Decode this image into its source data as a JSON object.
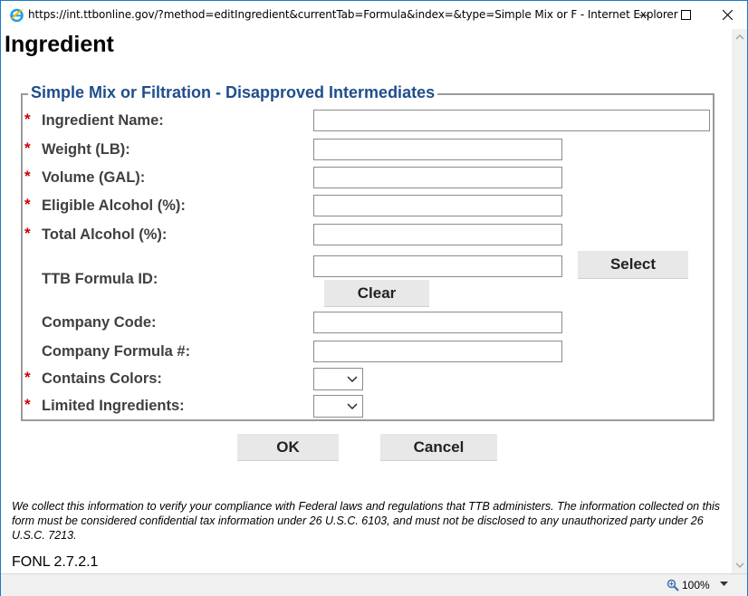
{
  "window": {
    "title": "https://int.ttbonline.gov/?method=editIngredient&currentTab=Formula&index=&type=Simple Mix or F - Internet Explorer"
  },
  "page": {
    "title": "Ingredient",
    "legend": "Simple Mix or Filtration - Disapproved Intermediates"
  },
  "form": {
    "required_marker": "*",
    "fields": {
      "ingredient_name": {
        "label": "Ingredient Name:",
        "value": ""
      },
      "weight": {
        "label": "Weight (LB):",
        "value": ""
      },
      "volume": {
        "label": "Volume (GAL):",
        "value": ""
      },
      "eligible_alcohol": {
        "label": "Eligible Alcohol (%):",
        "value": ""
      },
      "total_alcohol": {
        "label": "Total Alcohol (%):",
        "value": ""
      },
      "ttb_formula_id": {
        "label": "TTB Formula ID:",
        "value": ""
      },
      "company_code": {
        "label": "Company Code:",
        "value": ""
      },
      "company_formula": {
        "label": "Company Formula #:",
        "value": ""
      },
      "contains_colors": {
        "label": "Contains Colors:",
        "selected": ""
      },
      "limited_ingredients": {
        "label": "Limited Ingredients:",
        "selected": ""
      }
    },
    "select_label": "Select",
    "clear_label": "Clear",
    "ok_label": "OK",
    "cancel_label": "Cancel"
  },
  "footer": {
    "notice": "We collect this information to verify your compliance with Federal laws and regulations that TTB administers. The information collected on this form must be considered confidential tax information under 26 U.S.C. 6103, and must not be disclosed to any unauthorized party under 26 U.S.C. 7213.",
    "version": "FONL 2.7.2.1"
  },
  "statusbar": {
    "zoom": "100%"
  },
  "colors": {
    "legend": "#1f4e8c",
    "required": "#cc0000",
    "window_border": "#1979ca"
  },
  "icons": {
    "browser": "internet-explorer-icon",
    "zoom": "magnifier-icon"
  }
}
